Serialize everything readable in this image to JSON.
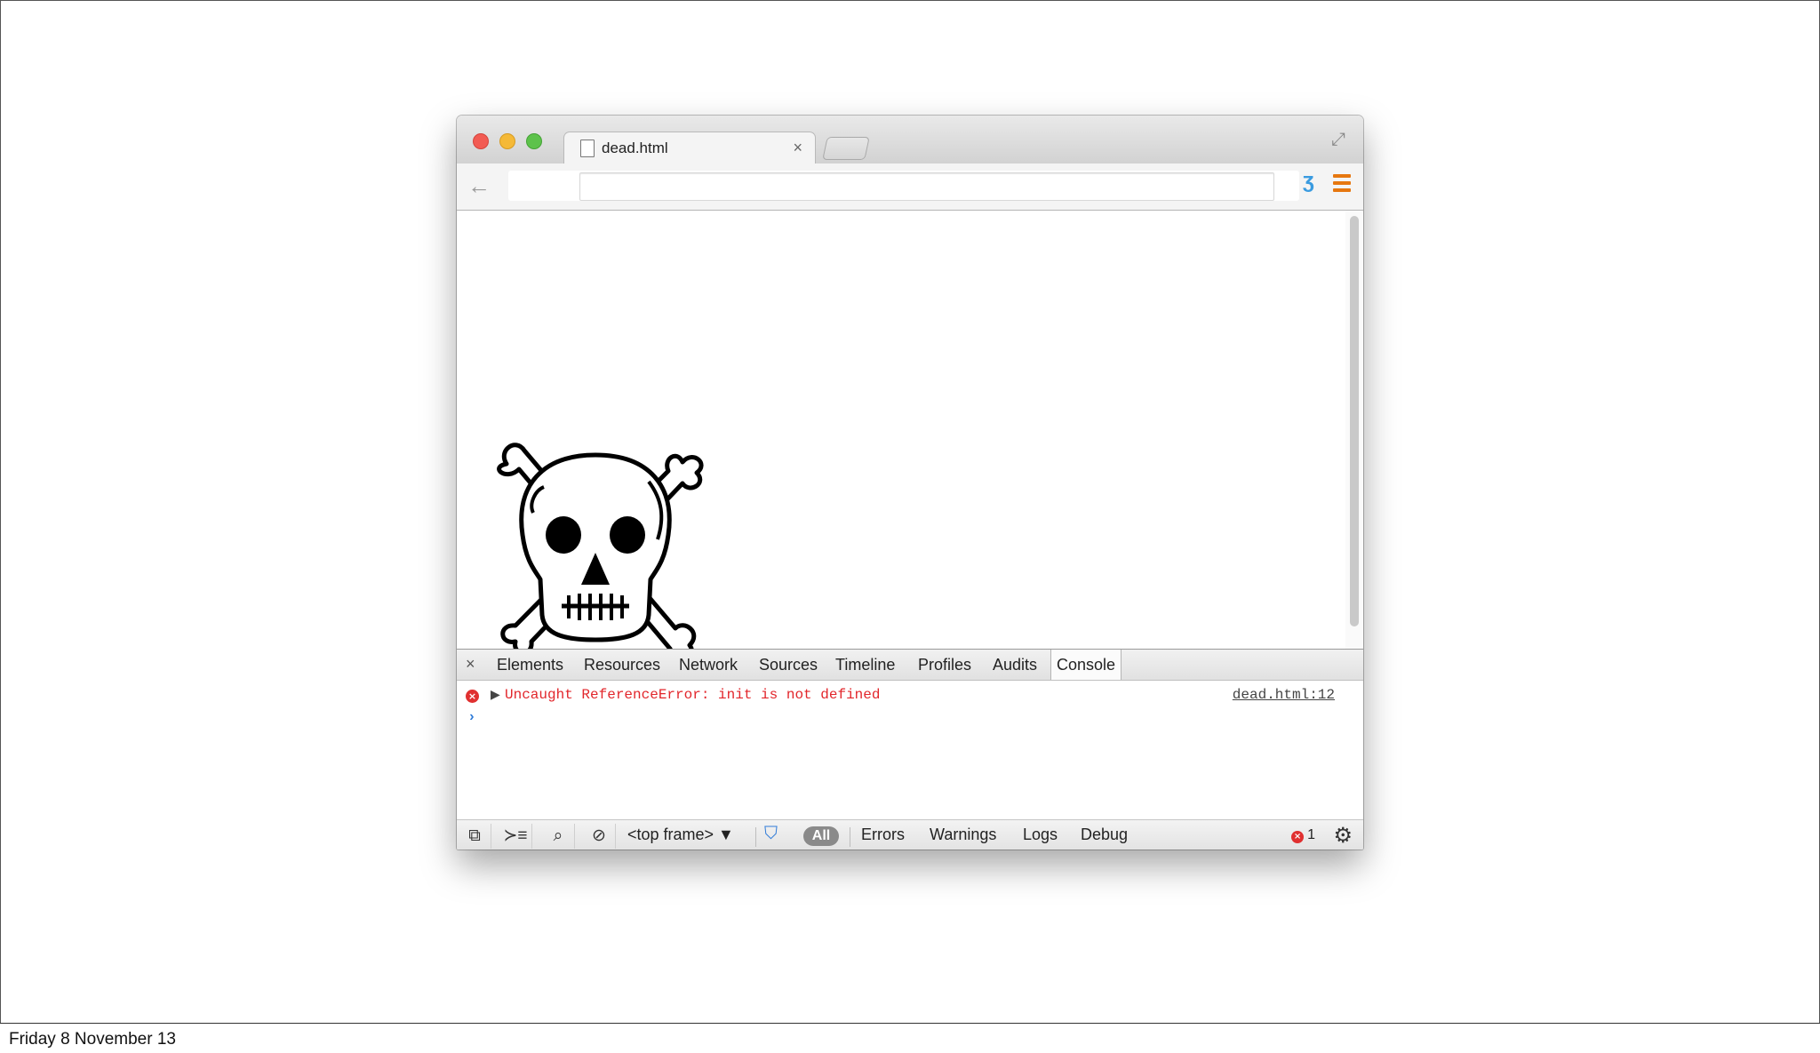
{
  "footer": {
    "date": "Friday 8 November 13"
  },
  "browser": {
    "tab_title": "dead.html",
    "tab_close": "×"
  },
  "devtools": {
    "close": "×",
    "tabs": [
      "Elements",
      "Resources",
      "Network",
      "Sources",
      "Timeline",
      "Profiles",
      "Audits",
      "Console"
    ],
    "active_tab": "Console",
    "console": {
      "error_message": "Uncaught ReferenceError: init is not defined",
      "error_source": "dead.html:12",
      "prompt": "›"
    },
    "statusbar": {
      "frame_select": "<top frame> ▼",
      "filter_all": "All",
      "levels": [
        "Errors",
        "Warnings",
        "Logs",
        "Debug"
      ],
      "error_count": "1"
    }
  },
  "icons": [
    "window-close-icon",
    "window-minimize-icon",
    "window-maximize-icon",
    "file-icon",
    "fullscreen-icon",
    "back-arrow-icon",
    "extension-icon",
    "menu-icon",
    "skull-crossbones-image",
    "error-icon",
    "expand-arrow-icon",
    "dock-icon",
    "console-drawer-icon",
    "search-icon",
    "clear-icon",
    "filter-icon",
    "gear-icon"
  ],
  "colors": {
    "error": "#e2262b",
    "menu": "#e6770f",
    "prompt": "#2f7bd8"
  }
}
